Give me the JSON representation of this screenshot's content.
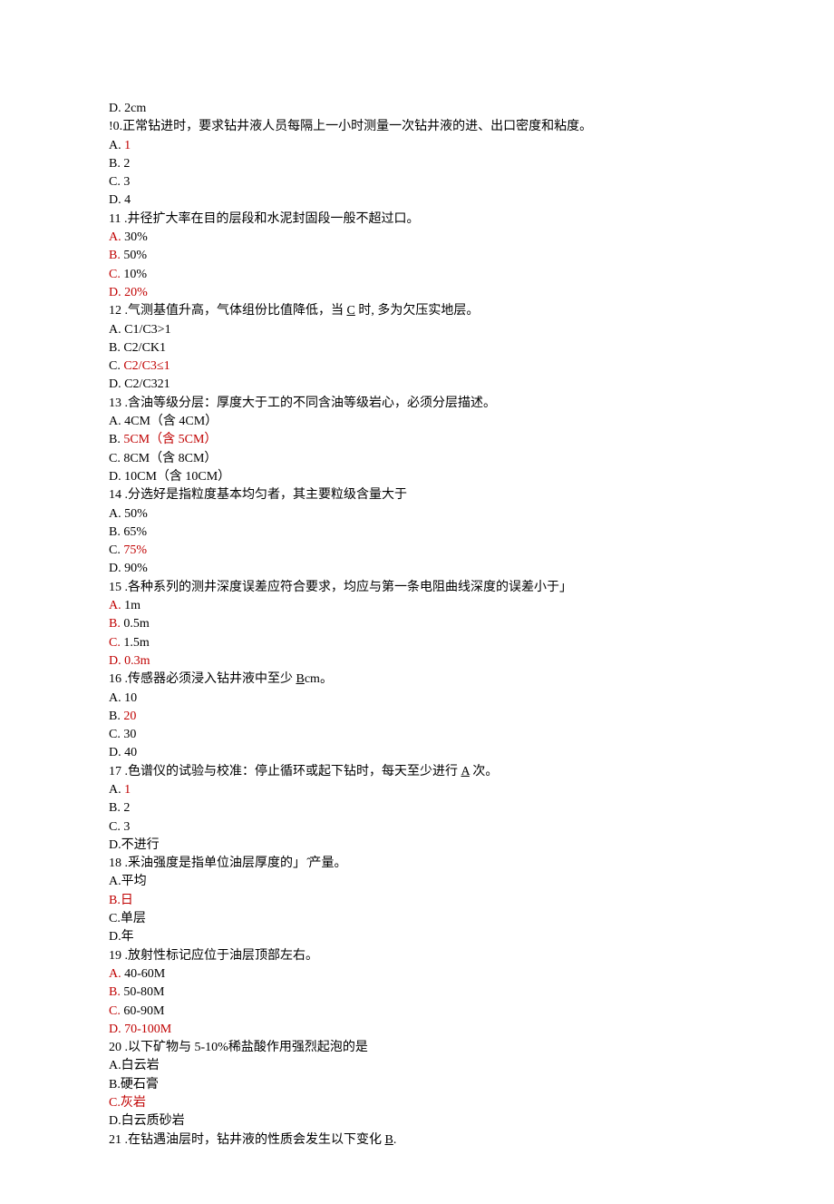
{
  "lines": [
    {
      "segments": [
        {
          "t": "D.   2cm"
        }
      ]
    },
    {
      "segments": [
        {
          "t": "!0.正常钻进时，要求钻井液人员每隔上一小时测量一次钻井液的进、出口密度和粘度。"
        }
      ]
    },
    {
      "segments": [
        {
          "t": "A.   "
        },
        {
          "t": "1",
          "c": "red"
        }
      ]
    },
    {
      "segments": [
        {
          "t": "B.   2"
        }
      ]
    },
    {
      "segments": [
        {
          "t": "C.   3"
        }
      ]
    },
    {
      "segments": [
        {
          "t": "D.   4"
        }
      ]
    },
    {
      "segments": [
        {
          "t": "11 .井径扩大率在目的层段和水泥封固段一般不超过口。"
        }
      ]
    },
    {
      "segments": [
        {
          "t": "A.",
          "c": "red"
        },
        {
          "t": "        30%"
        }
      ]
    },
    {
      "segments": [
        {
          "t": "B.",
          "c": "red"
        },
        {
          "t": "        50%"
        }
      ]
    },
    {
      "segments": [
        {
          "t": "C.",
          "c": "red"
        },
        {
          "t": "        10%"
        }
      ]
    },
    {
      "segments": [
        {
          "t": "D.        20%",
          "c": "red"
        }
      ]
    },
    {
      "segments": [
        {
          "t": "12 .气测基值升高，气体组份比值降低，当 "
        },
        {
          "t": "C",
          "u": true
        },
        {
          "t": " 时, 多为欠压实地层。"
        }
      ]
    },
    {
      "segments": [
        {
          "t": "A.   C1/C3>1"
        }
      ]
    },
    {
      "segments": [
        {
          "t": "B.   C2/CK1"
        }
      ]
    },
    {
      "segments": [
        {
          "t": "C.   "
        },
        {
          "t": "C2/C3≤1",
          "c": "red"
        }
      ]
    },
    {
      "segments": [
        {
          "t": "D.   C2/C321"
        }
      ]
    },
    {
      "segments": [
        {
          "t": "13 .含油等级分层：厚度大于工的不同含油等级岩心，必须分层描述。"
        }
      ]
    },
    {
      "segments": [
        {
          "t": "A.  4CM（含 4CM）"
        }
      ]
    },
    {
      "segments": [
        {
          "t": "B.  "
        },
        {
          "t": "5CM（含 5CM）",
          "c": "red"
        }
      ]
    },
    {
      "segments": [
        {
          "t": "C.  8CM（含 8CM）"
        }
      ]
    },
    {
      "segments": [
        {
          "t": "D.  10CM（含 10CM）"
        }
      ]
    },
    {
      "segments": [
        {
          "t": "14 .分选好是指粒度基本均匀者，其主要粒级含量大于"
        }
      ]
    },
    {
      "segments": [
        {
          "t": "A.  50%"
        }
      ]
    },
    {
      "segments": [
        {
          "t": "B.  65%"
        }
      ]
    },
    {
      "segments": [
        {
          "t": "C.  "
        },
        {
          "t": "75%",
          "c": "red"
        }
      ]
    },
    {
      "segments": [
        {
          "t": "D.  90%"
        }
      ]
    },
    {
      "segments": [
        {
          "t": "15 .各种系列的测井深度误差应符合要求，均应与第一条电阻曲线深度的误差小于」"
        }
      ]
    },
    {
      "segments": [
        {
          "t": "A.",
          "c": "red"
        },
        {
          "t": "   1m"
        }
      ]
    },
    {
      "segments": [
        {
          "t": "B.",
          "c": "red"
        },
        {
          "t": "  0.5m"
        }
      ]
    },
    {
      "segments": [
        {
          "t": "C.",
          "c": "red"
        },
        {
          "t": "   1.5m"
        }
      ]
    },
    {
      "segments": [
        {
          "t": "D.   0.3m",
          "c": "red"
        }
      ]
    },
    {
      "segments": [
        {
          "t": "16 .传感器必须浸入钻井液中至少 "
        },
        {
          "t": "B",
          "u": true
        },
        {
          "t": "cm。"
        }
      ]
    },
    {
      "segments": [
        {
          "t": "A.   10"
        }
      ]
    },
    {
      "segments": [
        {
          "t": "B.   "
        },
        {
          "t": "20",
          "c": "red"
        }
      ]
    },
    {
      "segments": [
        {
          "t": "C.   30"
        }
      ]
    },
    {
      "segments": [
        {
          "t": "D.   40"
        }
      ]
    },
    {
      "segments": [
        {
          "t": "17 .色谱仪的试验与校准：停止循环或起下钻时，每天至少进行 "
        },
        {
          "t": "A",
          "u": true
        },
        {
          "t": " 次。"
        }
      ]
    },
    {
      "segments": [
        {
          "t": "A.   "
        },
        {
          "t": "1",
          "c": "red"
        }
      ]
    },
    {
      "segments": [
        {
          "t": "B.   2"
        }
      ]
    },
    {
      "segments": [
        {
          "t": "C.   3"
        }
      ]
    },
    {
      "segments": [
        {
          "t": "D.不进行"
        }
      ]
    },
    {
      "segments": [
        {
          "t": "18 .釆油强度是指单位油层厚度的」  ̂产量。"
        }
      ]
    },
    {
      "segments": [
        {
          "t": "A.平均"
        }
      ]
    },
    {
      "segments": [
        {
          "t": "B.日",
          "c": "red"
        }
      ]
    },
    {
      "segments": [
        {
          "t": "C.单层"
        }
      ]
    },
    {
      "segments": [
        {
          "t": "D.年"
        }
      ]
    },
    {
      "segments": [
        {
          "t": "19 .放射性标记应位于油层顶部左右。"
        }
      ]
    },
    {
      "segments": [
        {
          "t": "A.",
          "c": "red"
        },
        {
          "t": "  40-60M"
        }
      ]
    },
    {
      "segments": [
        {
          "t": "B.",
          "c": "red"
        },
        {
          "t": "  50-80M"
        }
      ]
    },
    {
      "segments": [
        {
          "t": "C.",
          "c": "red"
        },
        {
          "t": "  60-90M"
        }
      ]
    },
    {
      "segments": [
        {
          "t": "D.  70-100M",
          "c": "red"
        }
      ]
    },
    {
      "segments": [
        {
          "t": "20   .以下矿物与 5-10%稀盐酸作用强烈起泡的是"
        }
      ]
    },
    {
      "segments": [
        {
          "t": "A.白云岩"
        }
      ]
    },
    {
      "segments": [
        {
          "t": "B.硬石膏"
        }
      ]
    },
    {
      "segments": [
        {
          "t": "C.灰岩",
          "c": "red"
        }
      ]
    },
    {
      "segments": [
        {
          "t": "D.白云质砂岩"
        }
      ]
    },
    {
      "segments": [
        {
          "t": "21 .在钻遇油层时，钻井液的性质会发生以下变化      "
        },
        {
          "t": "B",
          "u": true
        },
        {
          "t": "."
        }
      ]
    }
  ]
}
